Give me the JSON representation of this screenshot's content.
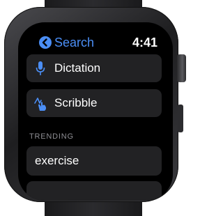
{
  "status_bar": {
    "back_label": "Search",
    "time": "4:41"
  },
  "menu": {
    "dictation_label": "Dictation",
    "scribble_label": "Scribble"
  },
  "trending": {
    "header": "TRENDING",
    "items": [
      {
        "label": "exercise"
      }
    ]
  },
  "colors": {
    "accent": "#4b8ef5",
    "row_bg": "#222224",
    "section_text": "#8e8e93"
  }
}
